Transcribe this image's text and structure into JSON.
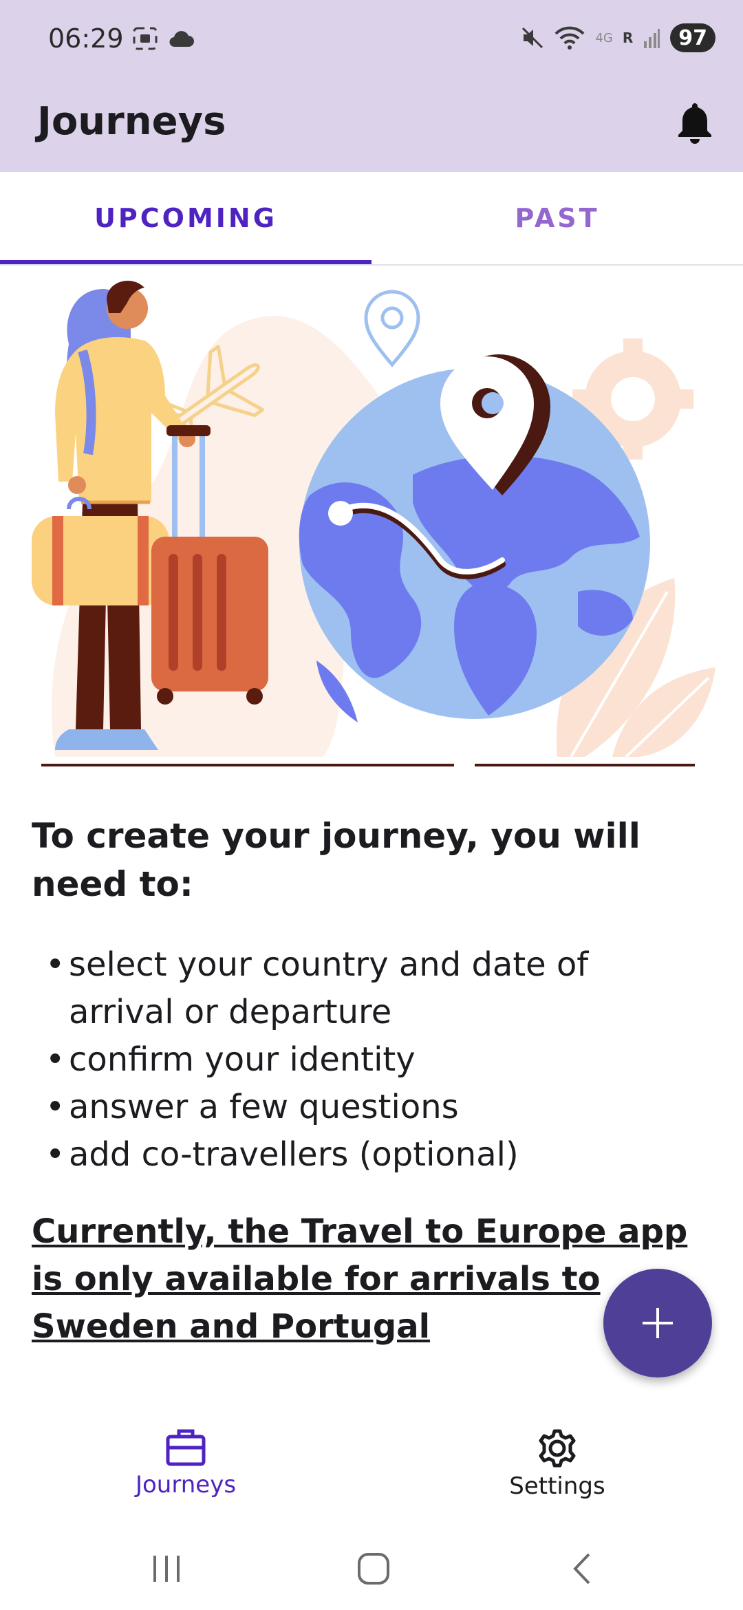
{
  "status_bar": {
    "time": "06:29",
    "battery": "97",
    "network": "4G",
    "sim_label": "R",
    "icons": [
      "screenshot-icon",
      "cloud-icon",
      "mute-icon",
      "wifi-icon",
      "signal-icon"
    ]
  },
  "app_bar": {
    "title": "Journeys",
    "icon": "bell-icon"
  },
  "tabs": [
    {
      "label": "UPCOMING",
      "active": true
    },
    {
      "label": "PAST",
      "active": false
    }
  ],
  "content": {
    "heading": "To create your journey, you will need to:",
    "bullets": [
      "select your country and date of arrival or departure",
      "confirm your identity",
      "answer a few questions",
      "add co-travellers (optional)"
    ],
    "notice": "Currently, the Travel to Europe app is only available for arrivals to Sweden and Portugal"
  },
  "fab": {
    "icon": "plus-icon"
  },
  "bottom_nav": [
    {
      "label": "Journeys",
      "icon": "briefcase-icon",
      "active": true
    },
    {
      "label": "Settings",
      "icon": "gear-icon",
      "active": false
    }
  ],
  "system_nav": [
    "recents-icon",
    "home-icon",
    "back-icon"
  ],
  "colors": {
    "app_bar_bg": "#dcd3ea",
    "primary": "#4f23c2",
    "tab_inactive": "#9467cf",
    "fab_bg": "#4f3f97"
  }
}
